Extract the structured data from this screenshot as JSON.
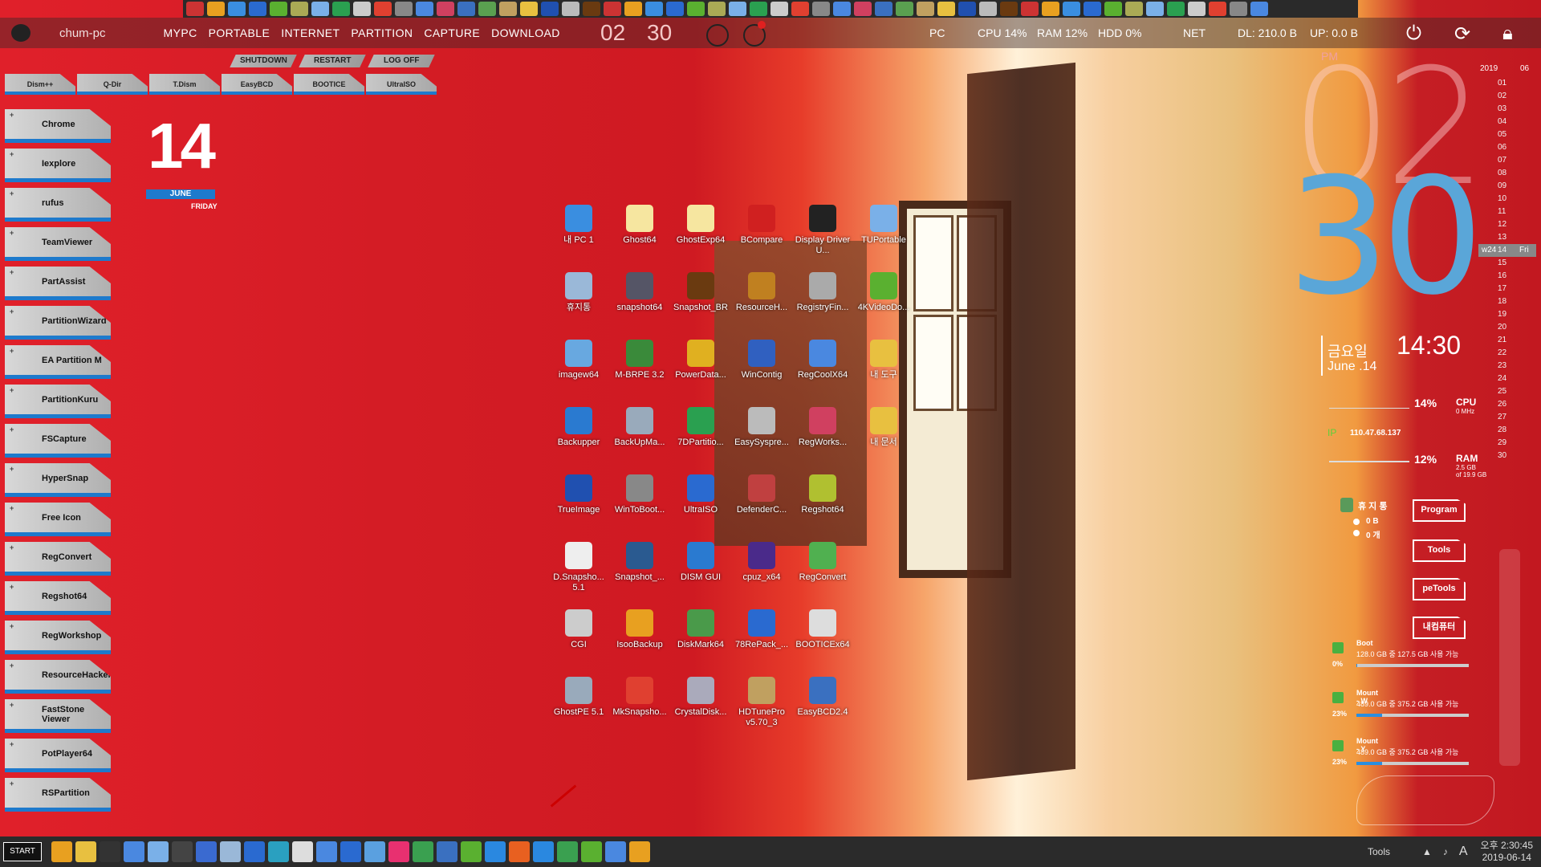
{
  "topbar": {
    "pc_name": "chum-pc",
    "menu": [
      "MYPC",
      "PORTABLE",
      "INTERNET",
      "PARTITION",
      "CAPTURE",
      "DOWNLOAD"
    ],
    "clock_hour": "02",
    "clock_min": "30",
    "pc_label": "PC",
    "cpu": "CPU 14%",
    "ram": "RAM 12%",
    "hdd": "HDD 0%",
    "net_label": "NET",
    "dl": "DL: 210.0 B",
    "up": "UP: 0.0 B"
  },
  "power_buttons": [
    "SHUTDOWN",
    "RESTART",
    "LOG OFF"
  ],
  "quick_tabs": [
    "Dism++",
    "Q-Dir",
    "T.Dism",
    "EasyBCD",
    "BOOTICE",
    "UltraISO"
  ],
  "side_items": [
    "Chrome",
    "Iexplore",
    "rufus",
    "TeamViewer",
    "PartAssist",
    "PartitionWizard",
    "EA Partition M",
    "PartitionKuru",
    "FSCapture",
    "HyperSnap",
    "Free Icon",
    "RegConvert",
    "Regshot64",
    "RegWorkshop",
    "ResourceHacker",
    "FastStone Viewer",
    "PotPlayer64",
    "RSPartition"
  ],
  "date_widget": {
    "day": "14",
    "month": "JUNE",
    "weekday": "FRIDAY"
  },
  "desktop_icons": [
    {
      "label": "내 PC 1",
      "color": "#3a8ee0"
    },
    {
      "label": "Ghost64",
      "color": "#f6e6a0"
    },
    {
      "label": "GhostExp64",
      "color": "#f6e6a0"
    },
    {
      "label": "BCompare",
      "color": "#d02020"
    },
    {
      "label": "Display Driver U...",
      "color": "#222"
    },
    {
      "label": "TUPortable",
      "color": "#7ab0e8"
    },
    {
      "label": "휴지통",
      "color": "#9ab8d8"
    },
    {
      "label": "snapshot64",
      "color": "#556"
    },
    {
      "label": "Snapshot_BR",
      "color": "#6a3a10"
    },
    {
      "label": "ResourceH...",
      "color": "#c08020"
    },
    {
      "label": "RegistryFin...",
      "color": "#aaa"
    },
    {
      "label": "4KVideoDo...",
      "color": "#5ab030"
    },
    {
      "label": "imagew64",
      "color": "#68a8e0"
    },
    {
      "label": "M-BRPE 3.2",
      "color": "#3a8a3a"
    },
    {
      "label": "PowerData...",
      "color": "#e0b020"
    },
    {
      "label": "WinContig",
      "color": "#3060c0"
    },
    {
      "label": "RegCoolX64",
      "color": "#4a88e0"
    },
    {
      "label": "내 도구",
      "color": "#e8c040"
    },
    {
      "label": "Backupper",
      "color": "#2a7ad0"
    },
    {
      "label": "BackUpMa...",
      "color": "#9ab"
    },
    {
      "label": "7DPartitio...",
      "color": "#2aa050"
    },
    {
      "label": "EasySyspre...",
      "color": "#bbb"
    },
    {
      "label": "RegWorks...",
      "color": "#d04060"
    },
    {
      "label": "내 문서",
      "color": "#e8c040"
    },
    {
      "label": "TrueImage",
      "color": "#2050b0"
    },
    {
      "label": "WinToBoot...",
      "color": "#888"
    },
    {
      "label": "UltraISO",
      "color": "#2a6ad0"
    },
    {
      "label": "DefenderC...",
      "color": "#c04040"
    },
    {
      "label": "Regshot64",
      "color": "#b0c030"
    },
    {
      "label": "",
      "color": "transparent"
    },
    {
      "label": "D.Snapsho... 5.1",
      "color": "#eee"
    },
    {
      "label": "Snapshot_...",
      "color": "#2a5a90"
    },
    {
      "label": "DISM GUI",
      "color": "#2a7ad0"
    },
    {
      "label": "cpuz_x64",
      "color": "#4a2a8a"
    },
    {
      "label": "RegConvert",
      "color": "#50b050"
    },
    {
      "label": "",
      "color": "transparent"
    },
    {
      "label": "CGI",
      "color": "#ccc"
    },
    {
      "label": "IsooBackup",
      "color": "#e8a020"
    },
    {
      "label": "DiskMark64",
      "color": "#4a9a4a"
    },
    {
      "label": "78RePack_...",
      "color": "#2a6ad0"
    },
    {
      "label": "BOOTICEx64",
      "color": "#ddd"
    },
    {
      "label": "",
      "color": "transparent"
    },
    {
      "label": "GhostPE 5.1",
      "color": "#9ab"
    },
    {
      "label": "MkSnapsho...",
      "color": "#e04030"
    },
    {
      "label": "CrystalDisk...",
      "color": "#aab"
    },
    {
      "label": "HDTunePro v5.70_3",
      "color": "#c0a060"
    },
    {
      "label": "EasyBCD2.4",
      "color": "#3a70c0"
    },
    {
      "label": "",
      "color": "transparent"
    }
  ],
  "big_clock": {
    "ampm": "PM",
    "hour": "02",
    "minute": "30"
  },
  "calendar": {
    "year": "2019",
    "month": "06",
    "week_label": "w24",
    "weekday_short": "Fri",
    "days": [
      "01",
      "02",
      "03",
      "04",
      "05",
      "06",
      "07",
      "08",
      "09",
      "10",
      "11",
      "12",
      "13",
      "14",
      "15",
      "16",
      "17",
      "18",
      "19",
      "20",
      "21",
      "22",
      "23",
      "24",
      "25",
      "26",
      "27",
      "28",
      "29",
      "30"
    ],
    "today": "14"
  },
  "korean_date": {
    "weekday": "금요일",
    "date": "June .14",
    "time": "14:30"
  },
  "sysmon": {
    "cpu_pct": "14%",
    "cpu_label": "CPU",
    "cpu_mhz": "0 MHz",
    "ip_label": "IP",
    "ip": "110.47.68.137",
    "ram_pct": "12%",
    "ram_label": "RAM",
    "ram_used": "2.5 GB",
    "ram_total": "of 19.9 GB"
  },
  "recycle": {
    "title": "휴 지 통",
    "size": "0 B",
    "count": "0 개"
  },
  "side_buttons": [
    "Program",
    "Tools",
    "peTools",
    "내컴퓨터"
  ],
  "disks": [
    {
      "name": "Boot",
      "info": "128.0 GB 중 127.5 GB 사용 가능",
      "pct": "0%",
      "fill": 0.004
    },
    {
      "name": "Mount - W",
      "info": "489.0 GB 중 375.2 GB 사용 가능",
      "pct": "23%",
      "fill": 0.23
    },
    {
      "name": "Mount - Y",
      "info": "489.0 GB 중 375.2 GB 사용 가능",
      "pct": "23%",
      "fill": 0.23
    }
  ],
  "taskbar": {
    "start": "START",
    "tools": "Tools",
    "time": "오후 2:30:45",
    "date": "2019-06-14",
    "ime": "A"
  }
}
